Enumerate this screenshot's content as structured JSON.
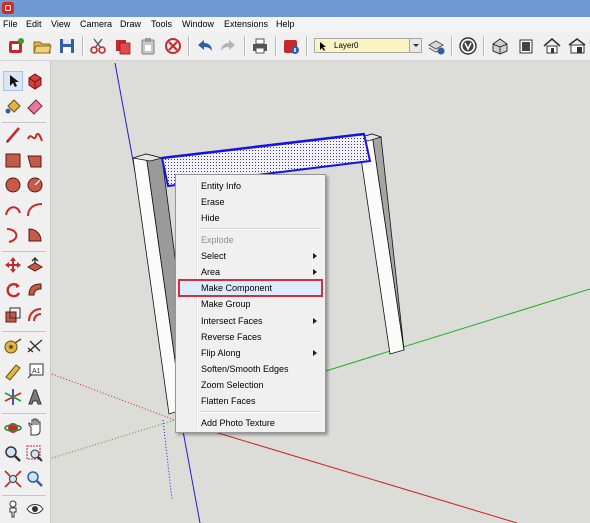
{
  "menubar": {
    "items": [
      "File",
      "Edit",
      "View",
      "Camera",
      "Draw",
      "Tools",
      "Window",
      "Extensions",
      "Help"
    ]
  },
  "toolbar": {
    "layer_value": "Layer0"
  },
  "context_menu": {
    "items": [
      {
        "label": "Entity Info"
      },
      {
        "label": "Erase"
      },
      {
        "label": "Hide"
      },
      {
        "label": "Explode",
        "disabled": true
      },
      {
        "label": "Select",
        "submenu": true
      },
      {
        "label": "Area",
        "submenu": true
      },
      {
        "label": "Make Component",
        "highlighted": true
      },
      {
        "label": "Make Group"
      },
      {
        "label": "Intersect Faces",
        "submenu": true
      },
      {
        "label": "Reverse Faces"
      },
      {
        "label": "Flip Along",
        "submenu": true
      },
      {
        "label": "Soften/Smooth Edges"
      },
      {
        "label": "Zoom Selection"
      },
      {
        "label": "Flatten Faces"
      },
      {
        "label": "Add Photo Texture"
      }
    ]
  },
  "colors": {
    "title_bar": "#6d9ad0",
    "viewport_background": "#dcdcd9",
    "selection_blue": "#1414e6",
    "highlight_border": "#d62e3c",
    "axis_red": "#d22020",
    "axis_green": "#20b020",
    "axis_blue": "#2020d0"
  }
}
